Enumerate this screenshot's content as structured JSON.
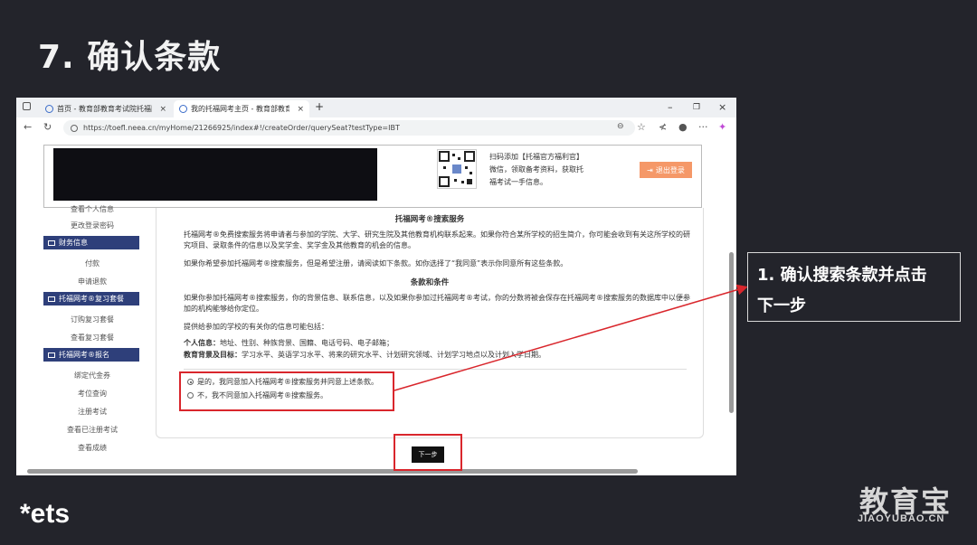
{
  "slide": {
    "title": "7. 确认条款"
  },
  "browser": {
    "tabs": [
      {
        "label": "首页 - 教育部教育考试院托福网上"
      },
      {
        "label": "我的托福网考主页 - 教育部教育考"
      }
    ],
    "new_tab": "+",
    "controls": {
      "minimize": "–",
      "restore": "❐",
      "close": "×"
    },
    "url": "https://toefl.neea.cn/myHome/21266925/index#!/createOrder/querySeat?testType=IBT"
  },
  "header": {
    "qr_caption": "扫码添加【托福官方福利官】微信，领取备考资料，获取托福考试一手信息。",
    "logout_label": "退出登录"
  },
  "sidebar": {
    "items": [
      {
        "type": "link",
        "label": "查看个人信息"
      },
      {
        "type": "link",
        "label": "更改登录密码"
      },
      {
        "type": "head",
        "label": "财务信息"
      },
      {
        "type": "link",
        "label": "付款"
      },
      {
        "type": "link",
        "label": "申请退款"
      },
      {
        "type": "head",
        "label": "托福网考®复习套餐"
      },
      {
        "type": "link",
        "label": "订购复习套餐"
      },
      {
        "type": "link",
        "label": "查看复习套餐"
      },
      {
        "type": "head",
        "label": "托福网考®报名"
      },
      {
        "type": "link",
        "label": "绑定代金券"
      },
      {
        "type": "link",
        "label": "考位查询"
      },
      {
        "type": "link",
        "label": "注册考试"
      },
      {
        "type": "link",
        "label": "查看已注册考试"
      },
      {
        "type": "link",
        "label": "查看成绩"
      }
    ]
  },
  "terms": {
    "title": "托福网考®搜索服务",
    "para1": "托福网考®免费搜索服务将申请者与参加的学院、大学、研究生院及其他教育机构联系起来。如果你符合某所学校的招生简介，你可能会收到有关这所学校的研究项目、录取条件的信息以及奖学金、奖学金及其他教育的机会的信息。",
    "para2": "如果你希望参加托福网考®搜索服务，但是希望注册，请阅读如下条款。如你选择了“我同意”表示你同意所有这些条款。",
    "section_title": "条款和条件",
    "para3": "如果你参加托福网考®搜索服务，你的背景信息、联系信息，以及如果你参加过托福网考®考试，你的分数将被会保存在托福网考®搜索服务的数据库中以便参加的机构能够给你定位。",
    "para4": "提供给参加的学校的有关你的信息可能包括：",
    "personal_label": "个人信息：",
    "personal_value": "地址、性别、种族背景、国籍、电话号码、电子邮箱；",
    "edu_label": "教育背景及目标：",
    "edu_value": "学习水平、英语学习水平、将来的研究水平、计划研究领域、计划学习地点以及计划入学日期。",
    "option_yes": "是的，我同意加入托福网考®搜索服务并同意上述条款。",
    "option_no": "不，我不同意加入托福网考®搜索服务。"
  },
  "next_button": "下一步",
  "callout": {
    "line1": "1. 确认搜索条款并点击",
    "line2": "下一步"
  },
  "logos": {
    "ets": "*ets",
    "jyb": "教育宝",
    "jyb_url": "JIAOYUBAO.CN"
  },
  "colors": {
    "slide_bg": "#23242b",
    "sidebar_head": "#2e3f7a",
    "logout": "#f59868",
    "highlight": "#d9262c"
  }
}
